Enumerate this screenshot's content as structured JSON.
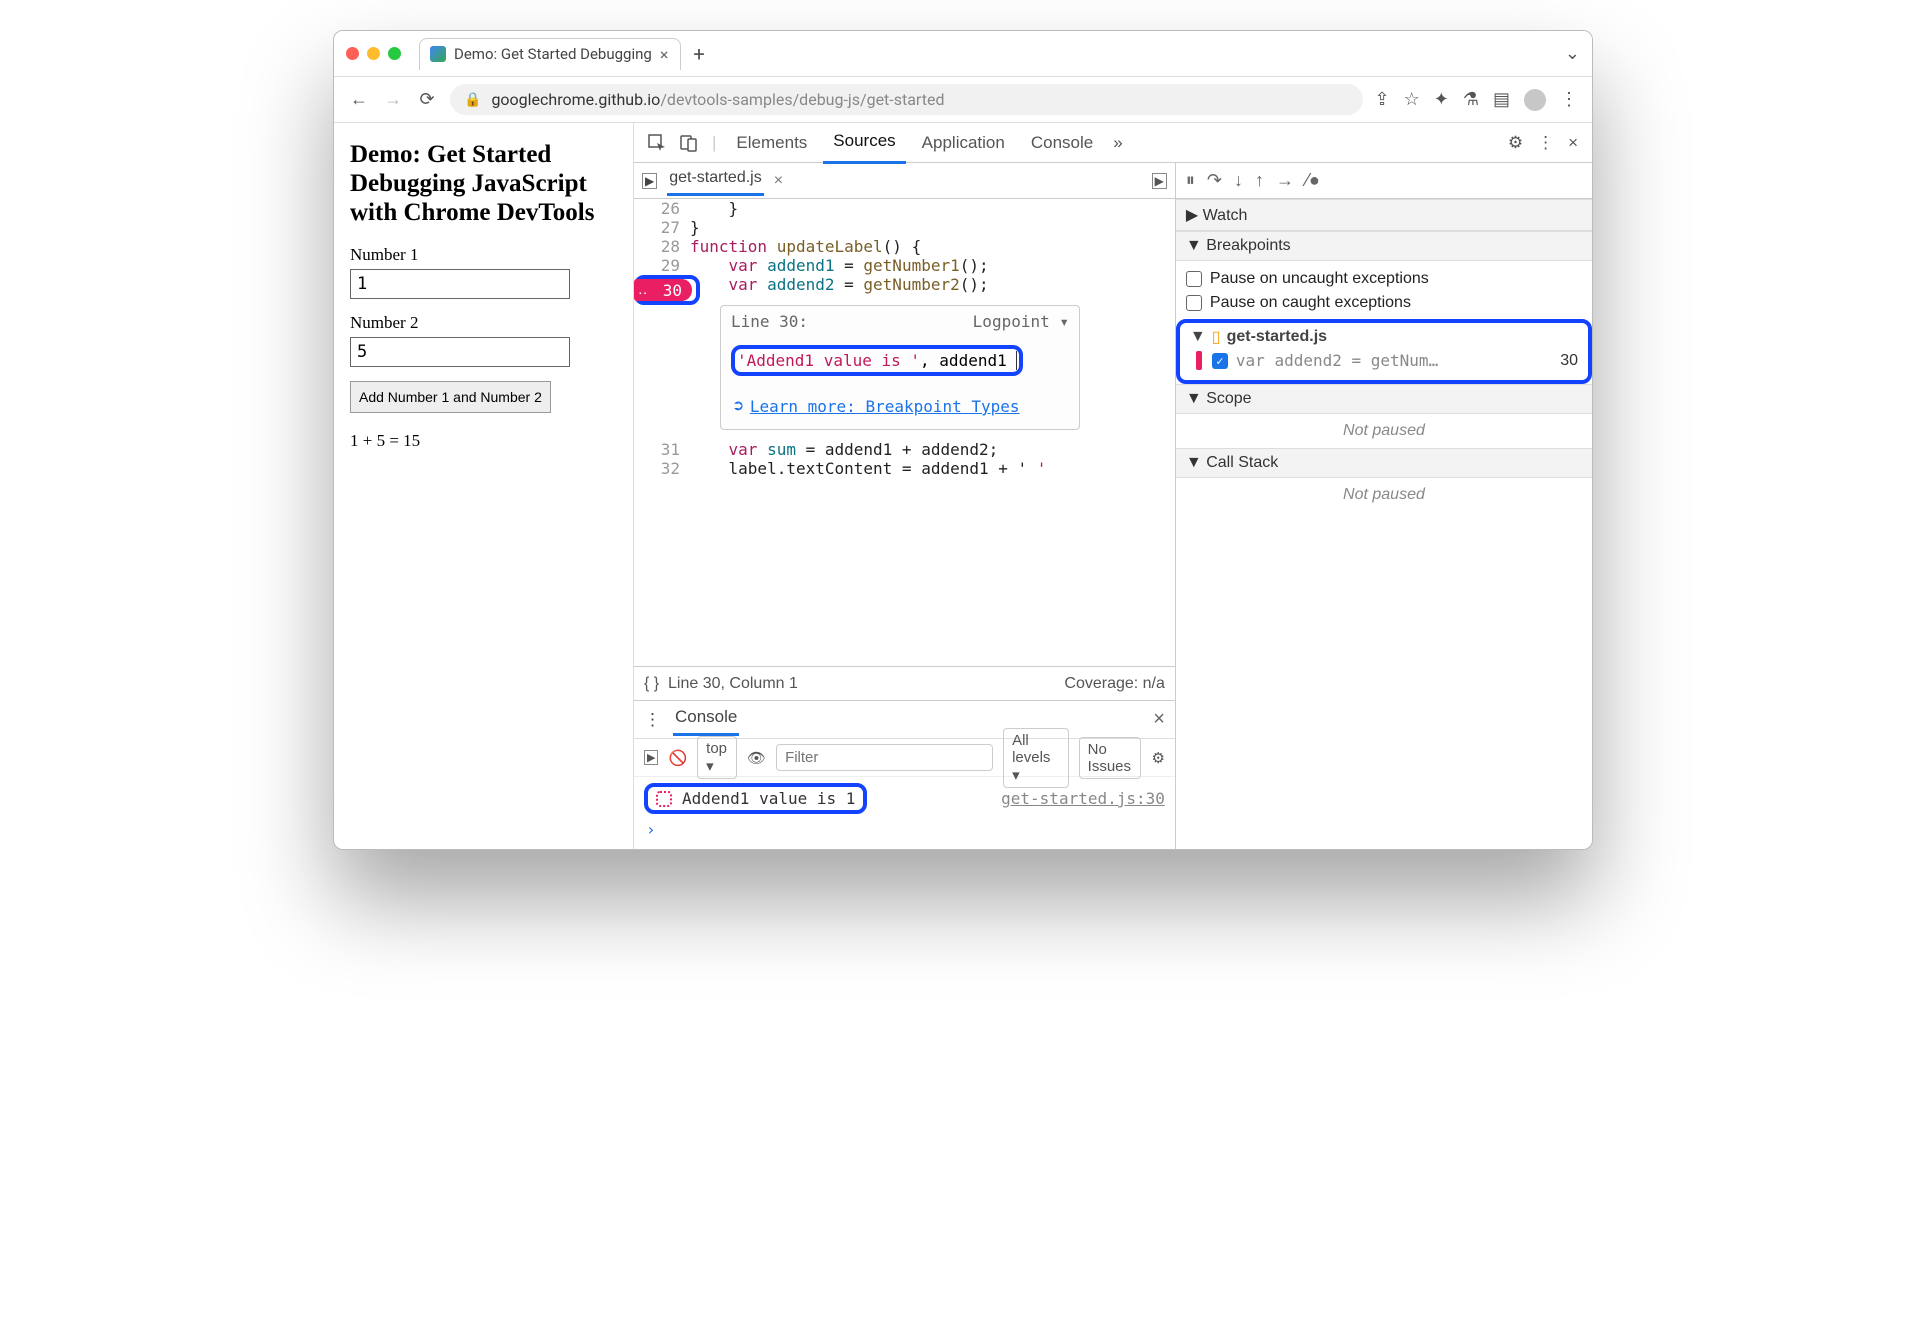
{
  "browser": {
    "tab_title": "Demo: Get Started Debugging",
    "url_host": "googlechrome.github.io",
    "url_path": "/devtools-samples/debug-js/get-started"
  },
  "page": {
    "heading": "Demo: Get Started Debugging JavaScript with Chrome DevTools",
    "label1": "Number 1",
    "input1": "1",
    "label2": "Number 2",
    "input2": "5",
    "button": "Add Number 1 and Number 2",
    "result": "1 + 5 = 15"
  },
  "devtools": {
    "tabs": {
      "elements": "Elements",
      "sources": "Sources",
      "application": "Application",
      "console": "Console"
    },
    "file_tab": "get-started.js",
    "code": {
      "l26": {
        "n": "26",
        "t": "    }"
      },
      "l27": {
        "n": "27",
        "t": "}"
      },
      "l28": {
        "n": "28",
        "pre": "function ",
        "fn": "updateLabel",
        "post": "() {"
      },
      "l29": {
        "n": "29",
        "pre": "    var ",
        "var": "addend1",
        "mid": " = ",
        "call": "getNumber1",
        "post": "();"
      },
      "l30": {
        "n": "30",
        "pre": "    var ",
        "var": "addend2",
        "mid": " = ",
        "call": "getNumber2",
        "post": "();"
      },
      "l31": {
        "n": "31",
        "pre": "    var ",
        "var": "sum",
        "mid": " = addend1 + addend2;"
      },
      "l32": {
        "n": "32",
        "t": "    label.textContent = addend1 + ' "
      }
    },
    "popover": {
      "head_left": "Line 30:",
      "head_right": "Logpoint",
      "body_str": "'Addend1 value is '",
      "body_rest": ", addend1",
      "learn": "Learn more: Breakpoint Types"
    },
    "status_left": "Line 30, Column 1",
    "status_right": "Coverage: n/a",
    "status_braces": "{ }",
    "side": {
      "watch": "Watch",
      "breakpoints": "Breakpoints",
      "pause_uncaught": "Pause on uncaught exceptions",
      "pause_caught": "Pause on caught exceptions",
      "bp_file": "get-started.js",
      "bp_text": "var addend2 = getNum…",
      "bp_line": "30",
      "scope": "Scope",
      "not_paused": "Not paused",
      "callstack": "Call Stack",
      "not_paused2": "Not paused"
    }
  },
  "console": {
    "tab": "Console",
    "top": "top",
    "filter_ph": "Filter",
    "levels": "All levels",
    "issues": "No Issues",
    "msg": "Addend1 value is  1",
    "src": "get-started.js:30"
  }
}
